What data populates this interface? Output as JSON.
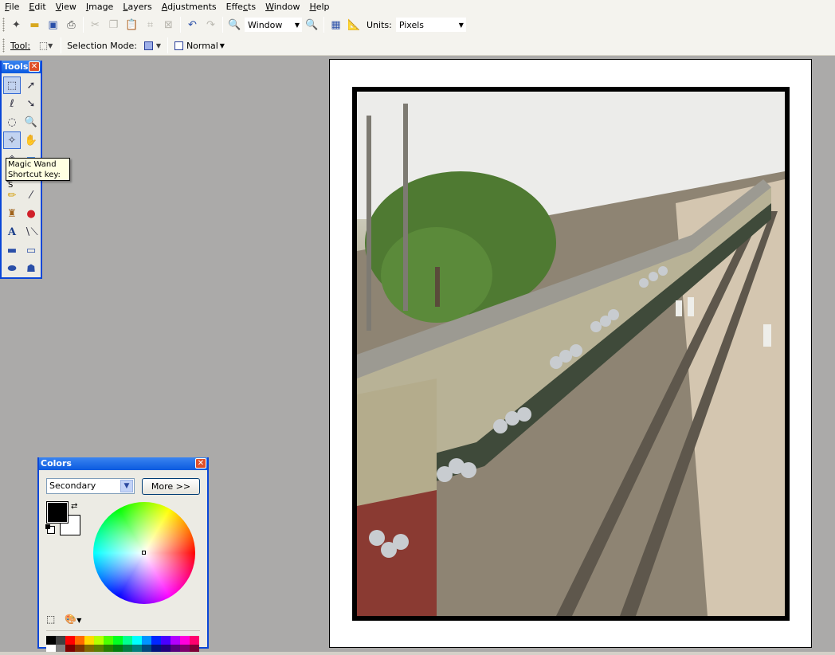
{
  "menu": [
    {
      "pre": "",
      "ul": "F",
      "post": "ile"
    },
    {
      "pre": "",
      "ul": "E",
      "post": "dit"
    },
    {
      "pre": "",
      "ul": "V",
      "post": "iew"
    },
    {
      "pre": "",
      "ul": "I",
      "post": "mage"
    },
    {
      "pre": "",
      "ul": "L",
      "post": "ayers"
    },
    {
      "pre": "",
      "ul": "A",
      "post": "djustments"
    },
    {
      "pre": "Effe",
      "ul": "c",
      "post": "ts"
    },
    {
      "pre": "",
      "ul": "W",
      "post": "indow"
    },
    {
      "pre": "",
      "ul": "H",
      "post": "elp"
    }
  ],
  "toolbar": {
    "zoom_value": "Window",
    "units_label": "Units:",
    "units_value": "Pixels",
    "tool_label": "Tool:",
    "selection_mode_label": "Selection Mode:",
    "blend_mode_value": "Normal"
  },
  "tools_window": {
    "title": "Tools",
    "tooltip_line1": "Magic Wand",
    "tooltip_line2": "Shortcut key: S"
  },
  "colors_window": {
    "title": "Colors",
    "selected": "Secondary",
    "more_button": "More >>",
    "primary_color": "#000000",
    "secondary_color": "#ffffff"
  },
  "colors": {
    "titlebar": "#0a5ae0",
    "window_border": "#0a46d8",
    "workspace": "#abaaa9",
    "tooltip_bg": "#ffffe1"
  },
  "palette_swatches": [
    "#000000",
    "#404040",
    "#ff0000",
    "#ff6a00",
    "#ffd800",
    "#b6ff00",
    "#4cff00",
    "#00ff21",
    "#00ff90",
    "#00ffff",
    "#0094ff",
    "#0026ff",
    "#4800ff",
    "#b200ff",
    "#ff00dc",
    "#ff006e",
    "#ffffff",
    "#808080",
    "#7f0000",
    "#7f3300",
    "#7f6a00",
    "#5b7f00",
    "#267f00",
    "#007f0e",
    "#007f46",
    "#007f7f",
    "#004a7f",
    "#00137f",
    "#21007f",
    "#57007f",
    "#7f006e",
    "#7f0037"
  ]
}
